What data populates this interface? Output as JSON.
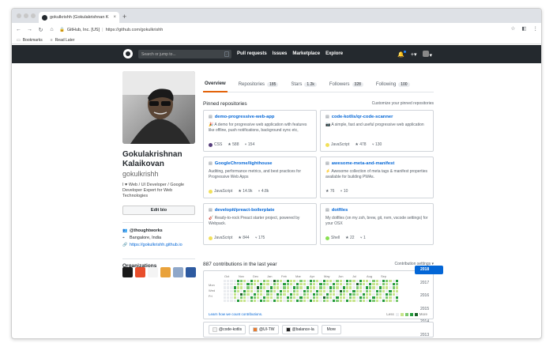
{
  "browser": {
    "tab_title": "gokulkrishh (Gokulakrishnan K",
    "new_tab_label": "+",
    "address_org": "GitHub, Inc. [US]",
    "address_url": "https://github.com/gokulkrishh",
    "bookmarks": [
      {
        "label": "Bookmarks"
      },
      {
        "label": "Read Later"
      }
    ]
  },
  "header": {
    "search_placeholder": "Search or jump to...",
    "search_key": "/",
    "nav": [
      "Pull requests",
      "Issues",
      "Marketplace",
      "Explore"
    ],
    "plus_label": "+▾"
  },
  "profile": {
    "name": "Gokulakrishnan Kalaikovan",
    "login": "gokulkrishh",
    "bio": "I ♥ Web / UI Developer / Google Developer Expert for Web Technologies",
    "edit_bio_label": "Edit bio",
    "company": "@thoughtworks",
    "location": "Bangalore, India",
    "website": "https://gokulkrishh.github.io",
    "orgs_title": "Organizations",
    "org_colors": [
      "#1a1a1a",
      "#e84e2c",
      "#f4f4f4",
      "#e9a23b",
      "#8fa7c9",
      "#2d5aa0"
    ]
  },
  "tabs": [
    {
      "label": "Overview",
      "count": ""
    },
    {
      "label": "Repositories",
      "count": "185"
    },
    {
      "label": "Stars",
      "count": "1.2k"
    },
    {
      "label": "Followers",
      "count": "328"
    },
    {
      "label": "Following",
      "count": "100"
    }
  ],
  "pinned": {
    "title": "Pinned repositories",
    "customize_label": "Customize your pinned repositories",
    "repos": [
      {
        "name": "demo-progressive-web-app",
        "desc": "🎉 A demo for progressive web application with features like offline, push notifications, background sync etc,",
        "lang": "CSS",
        "lang_color": "#563d7c",
        "stars": "588",
        "forks": "154"
      },
      {
        "name": "code-kotlis/qr-code-scanner",
        "desc": "📷 A simple, fast and useful progressive web application",
        "lang": "JavaScript",
        "lang_color": "#f1e05a",
        "stars": "478",
        "forks": "130"
      },
      {
        "name": "GoogleChrome/lighthouse",
        "desc": "Auditing, performance metrics, and best practices for Progressive Web Apps",
        "lang": "JavaScript",
        "lang_color": "#f1e05a",
        "stars": "14.9k",
        "forks": "4.8k"
      },
      {
        "name": "awesome-meta-and-manifest",
        "desc": "⚡ Awesome collection of meta tags & manifest properties available for building PWAs.",
        "lang": "",
        "lang_color": "",
        "stars": "76",
        "forks": "10"
      },
      {
        "name": "developit/preact-boilerplate",
        "desc": "🎸 Ready-to-rock Preact starter project, powered by Webpack.",
        "lang": "JavaScript",
        "lang_color": "#f1e05a",
        "stars": "844",
        "forks": "175"
      },
      {
        "name": "dotfiles",
        "desc": "My dotfiles (on my zsh, brew, git, nvm, vscode settings) for your OSX",
        "lang": "Shell",
        "lang_color": "#89e051",
        "stars": "22",
        "forks": "1"
      }
    ]
  },
  "contributions": {
    "title": "887 contributions in the last year",
    "settings_label": "Contribution settings ▾",
    "months": [
      "Oct",
      "Nov",
      "Dec",
      "Jan",
      "Feb",
      "Mar",
      "Apr",
      "May",
      "Jun",
      "Jul",
      "Aug",
      "Sep"
    ],
    "days": [
      "Mon",
      "Wed",
      "Fri"
    ],
    "learn_label": "Learn how we count contributions.",
    "less_label": "Less",
    "more_label": "More",
    "colors": [
      "#ebedf0",
      "#c6e48b",
      "#7bc96f",
      "#239a3b",
      "#196127"
    ]
  },
  "years": [
    "2018",
    "2017",
    "2016",
    "2015",
    "2014",
    "2013"
  ],
  "activity": {
    "chips": [
      {
        "label": "@code-kotlis",
        "color": "#f2f2f2"
      },
      {
        "label": "@UI-TW",
        "color": "#e87b2f"
      },
      {
        "label": "@balance-la",
        "color": "#222222"
      }
    ],
    "more_label": "More"
  }
}
